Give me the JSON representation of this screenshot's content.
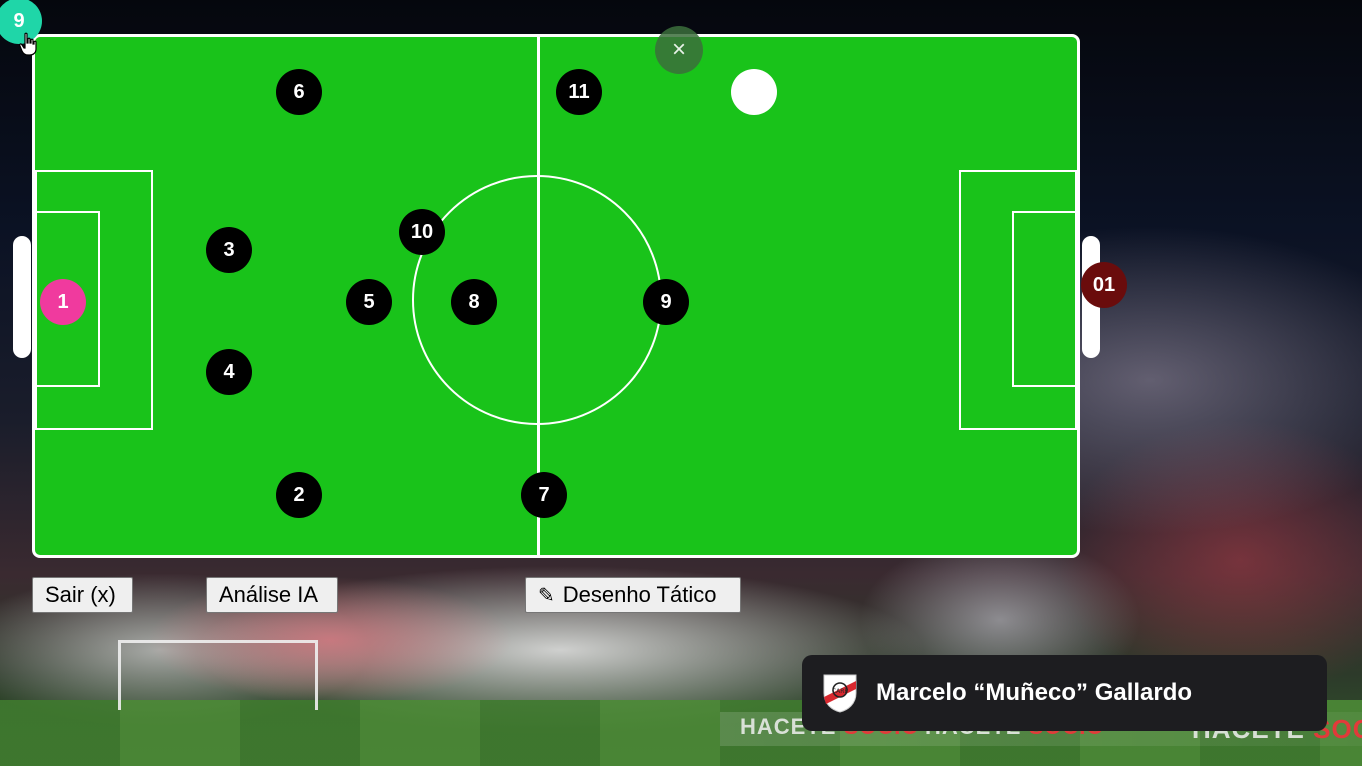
{
  "app": {
    "top_badge": "9"
  },
  "pitch": {
    "home_players": [
      {
        "number": "1",
        "role": "goalkeeper"
      },
      {
        "number": "2"
      },
      {
        "number": "3"
      },
      {
        "number": "4"
      },
      {
        "number": "5"
      },
      {
        "number": "6"
      },
      {
        "number": "7"
      },
      {
        "number": "8"
      },
      {
        "number": "9"
      },
      {
        "number": "10"
      },
      {
        "number": "11"
      }
    ],
    "opponent_token": "01",
    "close_icon": "×"
  },
  "toolbar": {
    "exit_label": "Sair (x)",
    "ai_analysis_label": "Análise IA",
    "tactical_drawing_icon": "✎",
    "tactical_drawing_label": "Desenho Tático"
  },
  "coach": {
    "name": "Marcelo “Muñeco” Gallardo",
    "crest_icon": "river-plate-crest"
  },
  "background_ads": {
    "text": "HACETE SOCIO",
    "highlight": "SOCIO"
  },
  "colors": {
    "pitch_green": "#19c31a",
    "player_black": "#000000",
    "goalkeeper_pink": "#f03a9e",
    "opponent_maroon": "#6a0c0c",
    "badge_teal": "#1fd6a8",
    "card_dark": "#1d1d20"
  }
}
